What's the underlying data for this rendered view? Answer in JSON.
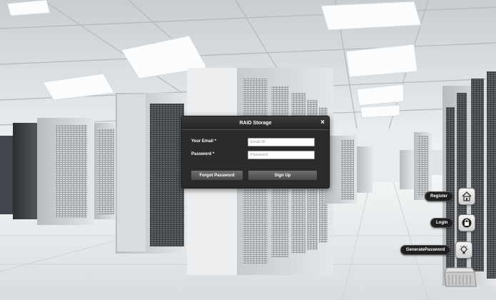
{
  "dialog": {
    "title": "RAID Storage",
    "close_icon": "×",
    "email_label": "Your Email *",
    "email_placeholder": "Email ID",
    "email_value": "",
    "password_label": "Password *",
    "password_placeholder": "Password",
    "password_value": "",
    "forgot_label": "Forgot Password",
    "signup_label": "Sign Up"
  },
  "side_menu": {
    "register_label": "Register",
    "register_icon": "home-icon",
    "login_label": "Login",
    "login_icon": "lock-icon",
    "generate_label": "GeneratePassword",
    "generate_icon": "lightbulb-icon"
  },
  "colors": {
    "dialog_bg": "#2b2b2b",
    "button_bg": "#5a5a5a",
    "menu_pill_bg": "#1f1f1f"
  }
}
